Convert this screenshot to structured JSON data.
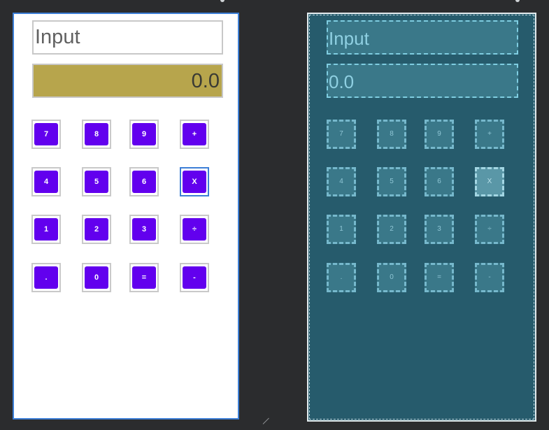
{
  "design": {
    "input_label": "Input",
    "result_value": "0.0",
    "keys": [
      {
        "label": "7"
      },
      {
        "label": "8"
      },
      {
        "label": "9"
      },
      {
        "label": "+"
      },
      {
        "label": "4"
      },
      {
        "label": "5"
      },
      {
        "label": "6"
      },
      {
        "label": "X",
        "selected": true
      },
      {
        "label": "1"
      },
      {
        "label": "2"
      },
      {
        "label": "3"
      },
      {
        "label": "÷"
      },
      {
        "label": "."
      },
      {
        "label": "0"
      },
      {
        "label": "="
      },
      {
        "label": "-"
      }
    ]
  },
  "blueprint": {
    "input_label": "Input",
    "result_value": "0.0",
    "keys": [
      {
        "label": "7"
      },
      {
        "label": "8"
      },
      {
        "label": "9"
      },
      {
        "label": "+"
      },
      {
        "label": "4"
      },
      {
        "label": "5"
      },
      {
        "label": "6"
      },
      {
        "label": "X",
        "selected": true
      },
      {
        "label": "1"
      },
      {
        "label": "2"
      },
      {
        "label": "3"
      },
      {
        "label": "÷"
      },
      {
        "label": "."
      },
      {
        "label": "0"
      },
      {
        "label": "="
      },
      {
        "label": "-"
      }
    ]
  },
  "colors": {
    "button_fill": "#6200ee",
    "result_background": "#b7a54c",
    "selection_outline": "#3d7fd6",
    "blueprint_background": "#265b6c",
    "blueprint_outline": "#7fcde1"
  }
}
